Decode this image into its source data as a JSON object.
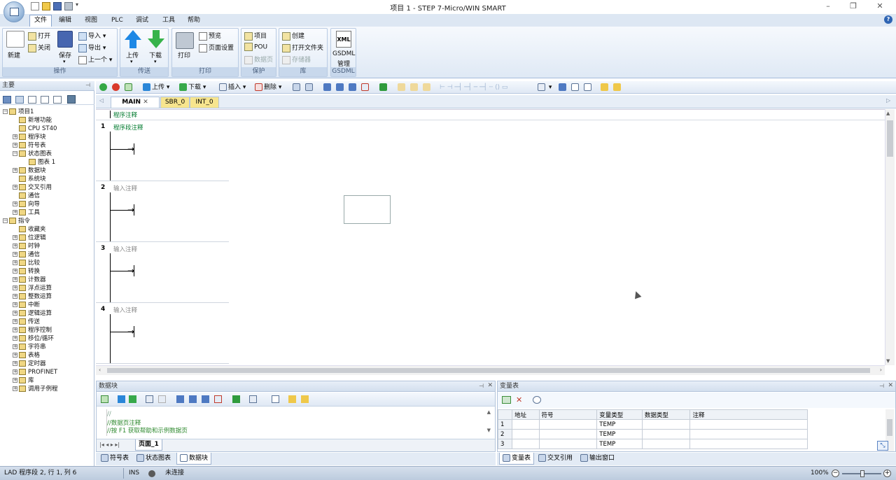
{
  "app": {
    "title": "项目 1 - STEP 7-Micro/WIN SMART"
  },
  "menu": {
    "items": [
      "文件",
      "编辑",
      "视图",
      "PLC",
      "调试",
      "工具",
      "帮助"
    ]
  },
  "ribbon": {
    "groups": [
      {
        "label": "操作",
        "buttons": [
          "新建",
          "打开",
          "关闭",
          "保存",
          "导入",
          "导出",
          "上一个"
        ]
      },
      {
        "label": "传送",
        "buttons": [
          "上传",
          "下载"
        ]
      },
      {
        "label": "打印",
        "buttons": [
          "打印",
          "预览",
          "页面设置"
        ]
      },
      {
        "label": "保护",
        "buttons": [
          "项目",
          "POU",
          "数据页"
        ]
      },
      {
        "label": "库",
        "buttons": [
          "创建",
          "打开文件夹",
          "存储器"
        ]
      },
      {
        "label": "GSDML",
        "buttons": [
          "GSDML",
          "管理"
        ]
      }
    ],
    "xml_icon_text": "XML"
  },
  "editor_toolbar": {
    "upload": "上传",
    "download": "下载",
    "insert": "插入",
    "delete": "删除"
  },
  "tabs": [
    "MAIN",
    "SBR_0",
    "INT_0"
  ],
  "left_pane": {
    "header": "主要",
    "tree": [
      {
        "label": "项目1",
        "level": 0,
        "exp": "−"
      },
      {
        "label": "新增功能",
        "level": 1,
        "exp": ""
      },
      {
        "label": "CPU ST40",
        "level": 1,
        "exp": ""
      },
      {
        "label": "程序块",
        "level": 1,
        "exp": "+"
      },
      {
        "label": "符号表",
        "level": 1,
        "exp": "+"
      },
      {
        "label": "状态图表",
        "level": 1,
        "exp": "−"
      },
      {
        "label": "图表 1",
        "level": 2,
        "exp": ""
      },
      {
        "label": "数据块",
        "level": 1,
        "exp": "+"
      },
      {
        "label": "系统块",
        "level": 1,
        "exp": ""
      },
      {
        "label": "交叉引用",
        "level": 1,
        "exp": "+"
      },
      {
        "label": "通信",
        "level": 1,
        "exp": ""
      },
      {
        "label": "向导",
        "level": 1,
        "exp": "+"
      },
      {
        "label": "工具",
        "level": 1,
        "exp": "+"
      },
      {
        "label": "指令",
        "level": 0,
        "exp": "−"
      },
      {
        "label": "收藏夹",
        "level": 1,
        "exp": ""
      },
      {
        "label": "位逻辑",
        "level": 1,
        "exp": "+"
      },
      {
        "label": "时钟",
        "level": 1,
        "exp": "+"
      },
      {
        "label": "通信",
        "level": 1,
        "exp": "+"
      },
      {
        "label": "比较",
        "level": 1,
        "exp": "+"
      },
      {
        "label": "转换",
        "level": 1,
        "exp": "+"
      },
      {
        "label": "计数器",
        "level": 1,
        "exp": "+"
      },
      {
        "label": "浮点运算",
        "level": 1,
        "exp": "+"
      },
      {
        "label": "整数运算",
        "level": 1,
        "exp": "+"
      },
      {
        "label": "中断",
        "level": 1,
        "exp": "+"
      },
      {
        "label": "逻辑运算",
        "level": 1,
        "exp": "+"
      },
      {
        "label": "传送",
        "level": 1,
        "exp": "+"
      },
      {
        "label": "程序控制",
        "level": 1,
        "exp": "+"
      },
      {
        "label": "移位/循环",
        "level": 1,
        "exp": "+"
      },
      {
        "label": "字符串",
        "level": 1,
        "exp": "+"
      },
      {
        "label": "表格",
        "level": 1,
        "exp": "+"
      },
      {
        "label": "定时器",
        "level": 1,
        "exp": "+"
      },
      {
        "label": "PROFINET",
        "level": 1,
        "exp": "+"
      },
      {
        "label": "库",
        "level": 1,
        "exp": "+"
      },
      {
        "label": "调用子例程",
        "level": 1,
        "exp": "+"
      }
    ]
  },
  "editor": {
    "program_comment": "程序注释",
    "networks": [
      {
        "num": "1",
        "comment": "程序段注释",
        "green": true
      },
      {
        "num": "2",
        "comment": "输入注释",
        "green": false
      },
      {
        "num": "3",
        "comment": "输入注释",
        "green": false
      },
      {
        "num": "4",
        "comment": "输入注释",
        "green": false
      }
    ]
  },
  "datablock": {
    "title": "数据块",
    "lines": [
      "//",
      "//数据页注释",
      "//按 F1 获取帮助和示例数据页"
    ],
    "page_tab": "页面_1"
  },
  "vartable": {
    "title": "变量表",
    "columns": [
      "地址",
      "符号",
      "变量类型",
      "数据类型",
      "注释"
    ],
    "rows": [
      {
        "num": "1",
        "type": "TEMP"
      },
      {
        "num": "2",
        "type": "TEMP"
      },
      {
        "num": "3",
        "type": "TEMP"
      }
    ]
  },
  "bottom_tabs_left": [
    "符号表",
    "状态图表",
    "数据块"
  ],
  "bottom_tabs_right": [
    "变量表",
    "交叉引用",
    "输出窗口"
  ],
  "status": {
    "position": "LAD 程序段 2, 行 1, 列 6",
    "mode": "INS",
    "connection": "未连接",
    "zoom": "100%"
  }
}
